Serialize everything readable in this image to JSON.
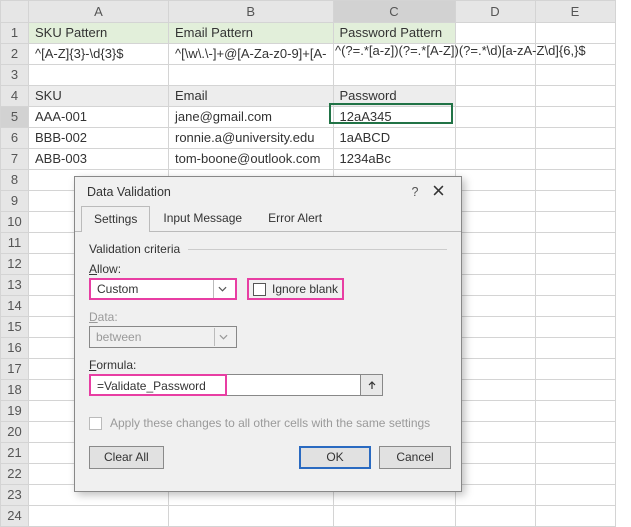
{
  "columns": [
    "A",
    "B",
    "C",
    "D",
    "E"
  ],
  "rows_visible": 24,
  "headers": {
    "a": "SKU Pattern",
    "b": "Email Pattern",
    "c": "Password Pattern"
  },
  "patterns": {
    "a": "^[A-Z]{3}-\\d{3}$",
    "b": "^[\\w\\.\\-]+@[A-Za-z0-9]+[A-",
    "c": "^(?=.*[a-z])(?=.*[A-Z])(?=.*\\d)[a-zA-Z\\d]{6,}$"
  },
  "subheaders": {
    "a": "SKU",
    "b": "Email",
    "c": "Password"
  },
  "data_rows": [
    {
      "a": "AAA-001",
      "b": "jane@gmail.com",
      "c": "12aA345"
    },
    {
      "a": "BBB-002",
      "b": "ronnie.a@university.edu",
      "c": "1aABCD"
    },
    {
      "a": "ABB-003",
      "b": "tom-boone@outlook.com",
      "c": "1234aBc"
    }
  ],
  "selected_cell": "C5",
  "dialog": {
    "title": "Data Validation",
    "help_glyph": "?",
    "tabs": {
      "settings": "Settings",
      "input": "Input Message",
      "error": "Error Alert"
    },
    "active_tab": "settings",
    "group_title": "Validation criteria",
    "allow_label_pre": "",
    "allow_label_u": "A",
    "allow_label_post": "llow:",
    "allow_value": "Custom",
    "ignore_blank_pre": "Ignore ",
    "ignore_blank_u": "b",
    "ignore_blank_post": "lank",
    "data_label_pre": "",
    "data_label_u": "D",
    "data_label_post": "ata:",
    "data_value": "between",
    "formula_label_pre": "",
    "formula_label_u": "F",
    "formula_label_post": "ormula:",
    "formula_value": "=Validate_Password",
    "apply_pre": "Apply these changes to all other cells with the same settings",
    "apply_u": "",
    "apply_post": "",
    "clear_pre": "",
    "clear_u": "C",
    "clear_post": "lear All",
    "ok": "OK",
    "cancel": "Cancel"
  }
}
